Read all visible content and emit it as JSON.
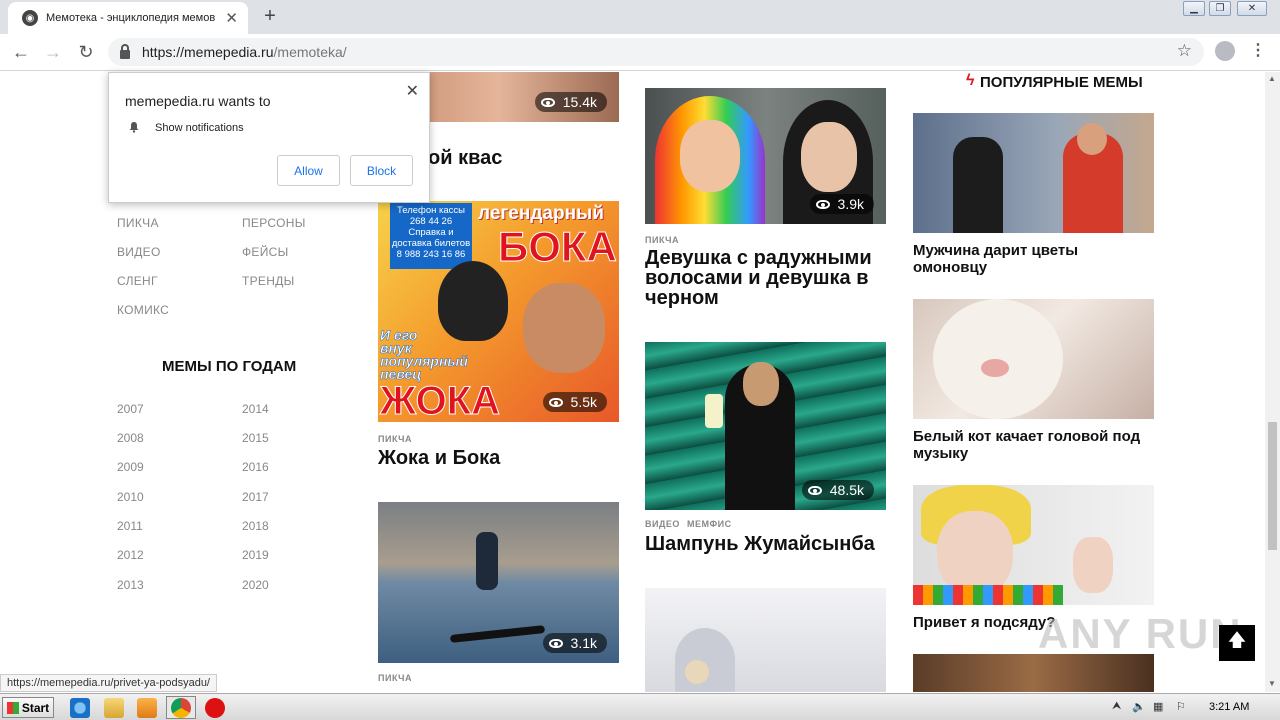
{
  "browser": {
    "tab_title": "Мемотека - энциклопедия мемов",
    "url_host": "https://memepedia.ru",
    "url_path": "/memoteka/",
    "status_url": "https://memepedia.ru/privet-ya-podsyadu/"
  },
  "notification": {
    "title": "memepedia.ru wants to",
    "text": "Show notifications",
    "allow": "Allow",
    "block": "Block"
  },
  "sidebar": {
    "categories_left": [
      "ПИКЧА",
      "ВИДЕО",
      "СЛЕНГ",
      "КОМИКС"
    ],
    "categories_right": [
      "ПЕРСОНЫ",
      "ФЕЙСЫ",
      "ТРЕНДЫ"
    ],
    "years_heading": "МЕМЫ ПО ГОДАМ",
    "years_left": [
      "2007",
      "2008",
      "2009",
      "2010",
      "2011",
      "2012",
      "2013"
    ],
    "years_right": [
      "2014",
      "2015",
      "2016",
      "2017",
      "2018",
      "2019",
      "2020"
    ]
  },
  "col1": {
    "top_views": "15.4k",
    "top_title_fragment": "ой квас",
    "card2": {
      "poster_top": "легендарный",
      "poster_boka": "БОКА",
      "poster_phone": "Телефон кассы\n268 44 26\nСправка и\nдоставка билетов\n8 988 243 16 86",
      "poster_mid": "И его\nвнук\nпопулярный\nпевец",
      "poster_zhoka": "ЖОКА",
      "views": "5.5k",
      "tag": "ПИКЧА",
      "title": "Жока и Бока"
    },
    "card3": {
      "views": "3.1k",
      "tag": "ПИКЧА"
    }
  },
  "col2": {
    "card1": {
      "views": "3.9k",
      "tag": "ПИКЧА",
      "title": "Девушка с радужными волосами и девушка в черном"
    },
    "card2": {
      "views": "48.5k",
      "tags": [
        "ВИДЕО",
        "МЕМФИС"
      ],
      "title": "Шампунь Жумайсынба"
    }
  },
  "popular": {
    "heading": "ПОПУЛЯРНЫЕ МЕМЫ",
    "items": [
      {
        "title": "Мужчина дарит цветы омоновцу"
      },
      {
        "title": "Белый кот качает головой под музыку"
      },
      {
        "title": "Привет я подсяду?"
      }
    ]
  },
  "watermark": "ANY RUN",
  "taskbar": {
    "start": "Start",
    "time": "3:21 AM"
  },
  "colors": {
    "accent_red": "#e0141e",
    "link_blue": "#1a73e8"
  }
}
